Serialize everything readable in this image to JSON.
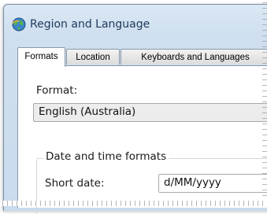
{
  "window": {
    "title": "Region and Language",
    "icon": "globe-icon"
  },
  "tabs": [
    {
      "label": "Formats",
      "active": true
    },
    {
      "label": "Location",
      "active": false
    },
    {
      "label": "Keyboards and Languages",
      "active": false
    }
  ],
  "formats": {
    "format_label": "Format:",
    "format_value": "English (Australia)",
    "group_title": "Date and time formats",
    "short_date_label": "Short date:",
    "short_date_value": "d/MM/yyyy"
  }
}
